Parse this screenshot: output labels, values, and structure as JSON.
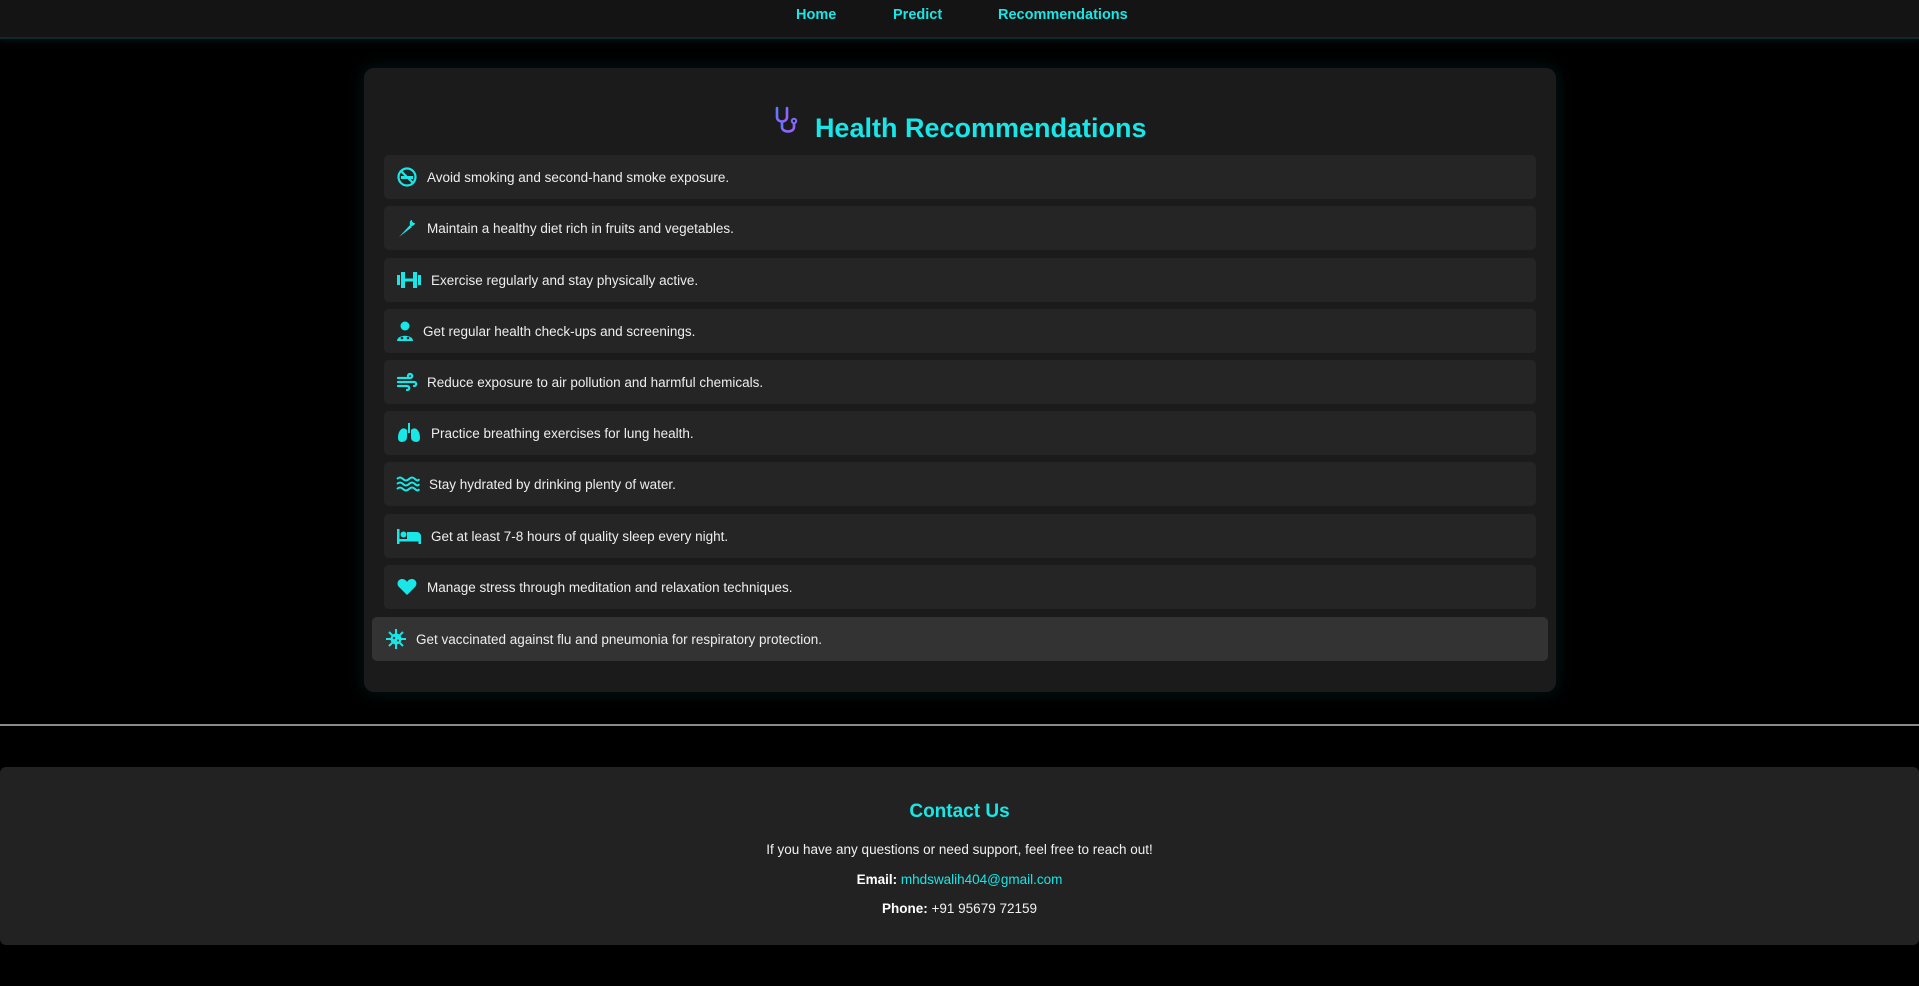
{
  "nav": {
    "home": "Home",
    "predict": "Predict",
    "recommendations": "Recommendations"
  },
  "header": {
    "title": "Health Recommendations",
    "icon": "stethoscope-icon"
  },
  "recommendations": [
    {
      "icon": "no-smoking-icon",
      "text": "Avoid smoking and second-hand smoke exposure."
    },
    {
      "icon": "carrot-icon",
      "text": "Maintain a healthy diet rich in fruits and vegetables."
    },
    {
      "icon": "dumbbell-icon",
      "text": "Exercise regularly and stay physically active."
    },
    {
      "icon": "doctor-icon",
      "text": "Get regular health check-ups and screenings."
    },
    {
      "icon": "wind-icon",
      "text": "Reduce exposure to air pollution and harmful chemicals."
    },
    {
      "icon": "lungs-icon",
      "text": "Practice breathing exercises for lung health."
    },
    {
      "icon": "water-icon",
      "text": "Stay hydrated by drinking plenty of water."
    },
    {
      "icon": "bed-icon",
      "text": "Get at least 7-8 hours of quality sleep every night."
    },
    {
      "icon": "heart-icon",
      "text": "Manage stress through meditation and relaxation techniques."
    },
    {
      "icon": "virus-icon",
      "text": "Get vaccinated against flu and pneumonia for respiratory protection."
    }
  ],
  "footer": {
    "title": "Contact Us",
    "message": "If you have any questions or need support, feel free to reach out!",
    "email_label": "Email:",
    "email": "mhdswalih404@gmail.com",
    "phone_label": "Phone:",
    "phone": "+91 95679 72159"
  },
  "colors": {
    "accent": "#19e6e6",
    "background": "#000000",
    "card": "#1b1b1b",
    "item": "#252525",
    "item_hover": "#333333"
  }
}
